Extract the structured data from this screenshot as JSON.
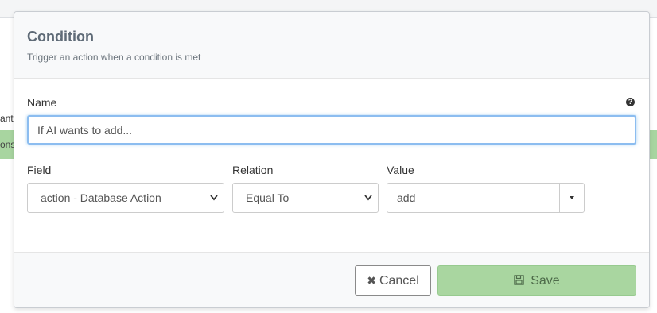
{
  "background": {
    "row_fragment": "ant",
    "green_row_fragment": "ons"
  },
  "modal": {
    "title": "Condition",
    "subtitle": "Trigger an action when a condition is met",
    "name_label": "Name",
    "help_icon": "?",
    "name_value": "If AI wants to add...",
    "field_label": "Field",
    "field_value": "action - Database Action",
    "relation_label": "Relation",
    "relation_value": "Equal To",
    "value_label": "Value",
    "value_value": "add",
    "cancel_label": "Cancel",
    "save_label": "Save",
    "icons": {
      "cancel": "times-icon",
      "save": "floppy-disk-icon",
      "help": "question-circle-icon",
      "dropdown": "caret-down-icon",
      "select_chevron": "chevron-down-icon"
    }
  }
}
